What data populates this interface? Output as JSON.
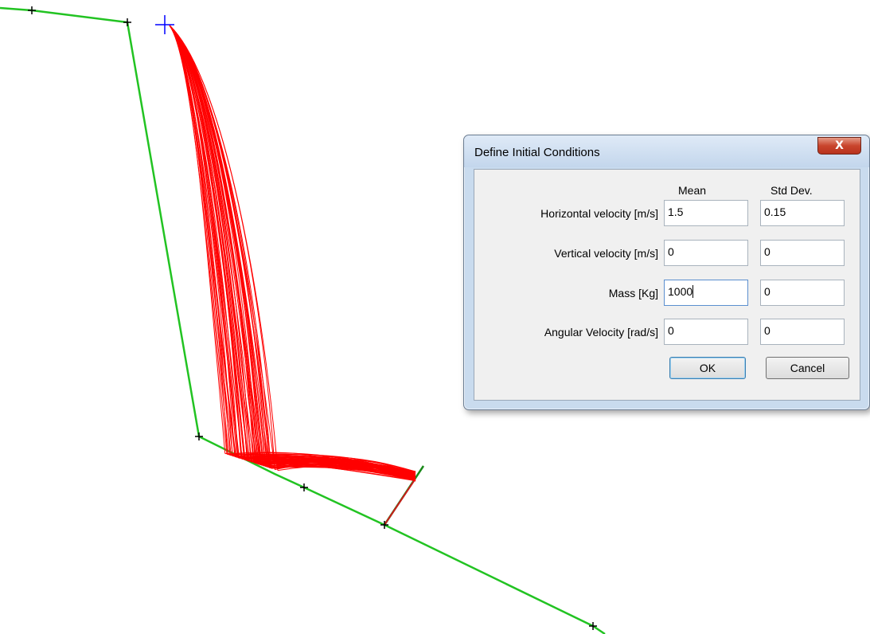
{
  "dialog": {
    "title": "Define Initial Conditions",
    "close_glyph": "X",
    "headers": {
      "mean": "Mean",
      "std": "Std Dev."
    },
    "rows": [
      {
        "label": "Horizontal velocity [m/s]",
        "mean": "1.5",
        "std": "0.15"
      },
      {
        "label": "Vertical velocity [m/s]",
        "mean": "0",
        "std": "0"
      },
      {
        "label": "Mass [Kg]",
        "mean": "1000",
        "std": "0"
      },
      {
        "label": "Angular Velocity [rad/s]",
        "mean": "0",
        "std": "0"
      }
    ],
    "buttons": {
      "ok": "OK",
      "cancel": "Cancel"
    }
  },
  "colors": {
    "slope": "#22c322",
    "paths": "#ff0000",
    "vertex": "#000000",
    "seeder": "#0000ff",
    "barrier": "#1a8a1a"
  }
}
